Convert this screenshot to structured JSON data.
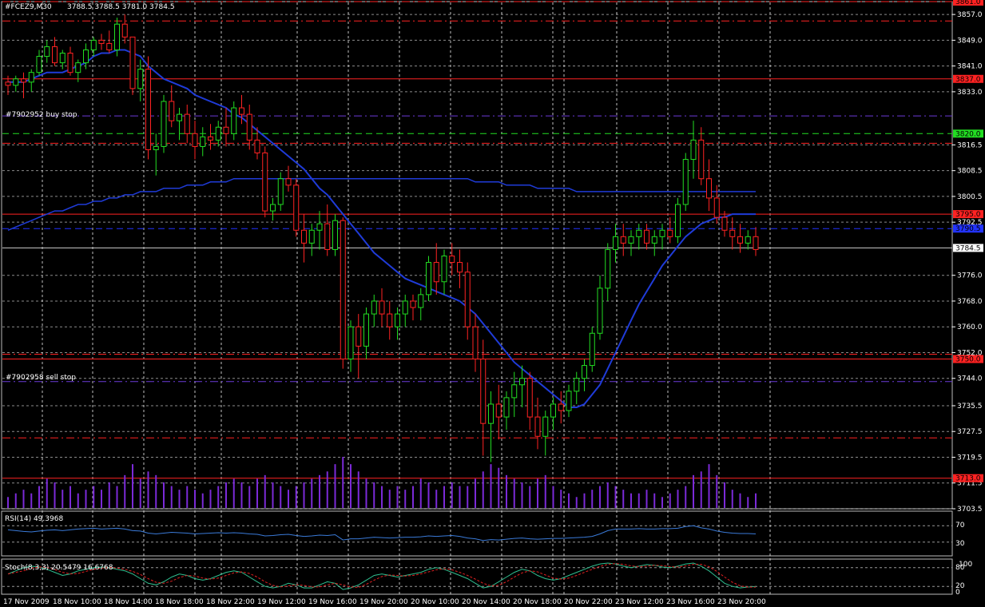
{
  "header": {
    "symbol_tf": "#FCEZ9,M30",
    "ohlc": "3788.5 3788.5 3781.0 3784.5"
  },
  "annotations": {
    "buy_stop": "#7902952 buy stop",
    "sell_stop": "#7902958 sell stop"
  },
  "indicators": {
    "rsi_label": "RSI(14) 49.3968",
    "rsi_levels": [
      "70",
      "30"
    ],
    "stoch_label": "Stoch(8,3,3) 20.5479 16.6768",
    "stoch_levels": [
      "80",
      "20"
    ],
    "stoch_top": "100",
    "stoch_bottom": "0"
  },
  "colors": {
    "background": "#000000",
    "bull_candle": "#22dd22",
    "bear_candle": "#ff2222",
    "moving_average": "#1f3bd8",
    "volume": "#7b2ad8",
    "grid": "#ffffff",
    "indicator_line": "#3a7ad8",
    "signal_line": "#e02020"
  },
  "chart_data": {
    "type": "candlestick",
    "symbol": "#FCEZ9",
    "timeframe": "M30",
    "y_ticks": [
      "3857.0",
      "3849.0",
      "3841.0",
      "3833.0",
      "3816.5",
      "3808.5",
      "3800.5",
      "3792.5",
      "3776.0",
      "3768.0",
      "3760.0",
      "3752.0",
      "3744.0",
      "3735.5",
      "3727.5",
      "3719.5",
      "3711.5",
      "3703.5"
    ],
    "ylim": [
      3703.5,
      3861.0
    ],
    "x_labels": [
      "17 Nov 2009",
      "18 Nov 10:00",
      "18 Nov 14:00",
      "18 Nov 18:00",
      "18 Nov 22:00",
      "19 Nov 12:00",
      "19 Nov 16:00",
      "19 Nov 20:00",
      "20 Nov 10:00",
      "20 Nov 14:00",
      "20 Nov 18:00",
      "20 Nov 22:00",
      "23 Nov 12:00",
      "23 Nov 16:00",
      "23 Nov 20:00"
    ],
    "current_price": "3784.5",
    "price_levels": [
      {
        "value": 3861.0,
        "label": "3861.0",
        "style": "dashdot",
        "color": "#ff2222"
      },
      {
        "value": 3837.0,
        "label": "3837.0",
        "style": "solid",
        "color": "#ff2222"
      },
      {
        "value": 3820.0,
        "label": "3820.0",
        "style": "dashed",
        "color": "#22dd22"
      },
      {
        "value": 3795.0,
        "label": "3795.0",
        "style": "solid",
        "color": "#ff2222"
      },
      {
        "value": 3790.5,
        "label": "3790.5",
        "style": "dashed",
        "color": "#2233ff"
      },
      {
        "value": 3750.0,
        "label": "3750.0",
        "style": "solid",
        "color": "#ff2222"
      },
      {
        "value": 3713.0,
        "label": "3713.0",
        "style": "solid",
        "color": "#ff2222"
      }
    ],
    "other_levels": [
      3855.0,
      3825.5,
      3817.0,
      3751.5,
      3743.0,
      3725.5
    ],
    "candles": [
      [
        3836,
        3838,
        3832,
        3835
      ],
      [
        3835,
        3838,
        3833,
        3837
      ],
      [
        3837,
        3839,
        3831,
        3836
      ],
      [
        3836,
        3840,
        3833,
        3839
      ],
      [
        3839,
        3846,
        3838,
        3844
      ],
      [
        3844,
        3849,
        3842,
        3847
      ],
      [
        3847,
        3850,
        3841,
        3842
      ],
      [
        3842,
        3846,
        3840,
        3845
      ],
      [
        3845,
        3847,
        3838,
        3839
      ],
      [
        3839,
        3843,
        3836,
        3842
      ],
      [
        3842,
        3848,
        3840,
        3846
      ],
      [
        3846,
        3850,
        3844,
        3849
      ],
      [
        3849,
        3851,
        3846,
        3848
      ],
      [
        3848,
        3852,
        3845,
        3846
      ],
      [
        3846,
        3856,
        3844,
        3854
      ],
      [
        3854,
        3857,
        3848,
        3850
      ],
      [
        3850,
        3846,
        3832,
        3834
      ],
      [
        3834,
        3843,
        3830,
        3840
      ],
      [
        3840,
        3844,
        3812,
        3815
      ],
      [
        3815,
        3820,
        3807,
        3816
      ],
      [
        3816,
        3832,
        3814,
        3830
      ],
      [
        3830,
        3835,
        3822,
        3824
      ],
      [
        3824,
        3828,
        3818,
        3826
      ],
      [
        3826,
        3829,
        3817,
        3820
      ],
      [
        3820,
        3824,
        3812,
        3816
      ],
      [
        3816,
        3822,
        3813,
        3819
      ],
      [
        3819,
        3823,
        3815,
        3818
      ],
      [
        3818,
        3824,
        3816,
        3822
      ],
      [
        3822,
        3828,
        3816,
        3820
      ],
      [
        3820,
        3830,
        3818,
        3828
      ],
      [
        3828,
        3832,
        3823,
        3826
      ],
      [
        3826,
        3829,
        3815,
        3818
      ],
      [
        3818,
        3822,
        3812,
        3814
      ],
      [
        3814,
        3816,
        3794,
        3796
      ],
      [
        3796,
        3800,
        3793,
        3798
      ],
      [
        3798,
        3808,
        3796,
        3806
      ],
      [
        3806,
        3810,
        3802,
        3804
      ],
      [
        3804,
        3806,
        3788,
        3790
      ],
      [
        3790,
        3795,
        3780,
        3786
      ],
      [
        3786,
        3792,
        3782,
        3790
      ],
      [
        3790,
        3796,
        3784,
        3792
      ],
      [
        3792,
        3798,
        3782,
        3784
      ],
      [
        3784,
        3795,
        3782,
        3793
      ],
      [
        3793,
        3794,
        3747,
        3750
      ],
      [
        3750,
        3762,
        3746,
        3760
      ],
      [
        3760,
        3764,
        3744,
        3754
      ],
      [
        3754,
        3766,
        3750,
        3764
      ],
      [
        3764,
        3770,
        3760,
        3768
      ],
      [
        3768,
        3772,
        3760,
        3764
      ],
      [
        3764,
        3768,
        3756,
        3760
      ],
      [
        3760,
        3766,
        3756,
        3764
      ],
      [
        3764,
        3770,
        3760,
        3768
      ],
      [
        3768,
        3770,
        3762,
        3766
      ],
      [
        3766,
        3772,
        3762,
        3770
      ],
      [
        3770,
        3782,
        3768,
        3780
      ],
      [
        3780,
        3786,
        3770,
        3774
      ],
      [
        3774,
        3784,
        3770,
        3782
      ],
      [
        3782,
        3786,
        3776,
        3780
      ],
      [
        3780,
        3784,
        3772,
        3777
      ],
      [
        3777,
        3780,
        3756,
        3760
      ],
      [
        3760,
        3764,
        3746,
        3750
      ],
      [
        3750,
        3756,
        3720,
        3730
      ],
      [
        3730,
        3740,
        3718,
        3736
      ],
      [
        3736,
        3742,
        3725,
        3732
      ],
      [
        3732,
        3740,
        3728,
        3738
      ],
      [
        3738,
        3746,
        3732,
        3742
      ],
      [
        3742,
        3748,
        3735,
        3744
      ],
      [
        3744,
        3746,
        3728,
        3732
      ],
      [
        3732,
        3738,
        3722,
        3726
      ],
      [
        3726,
        3734,
        3720,
        3732
      ],
      [
        3732,
        3738,
        3728,
        3736
      ],
      [
        3736,
        3740,
        3730,
        3734
      ],
      [
        3734,
        3742,
        3732,
        3740
      ],
      [
        3740,
        3746,
        3736,
        3744
      ],
      [
        3744,
        3750,
        3740,
        3748
      ],
      [
        3748,
        3760,
        3746,
        3758
      ],
      [
        3758,
        3776,
        3756,
        3772
      ],
      [
        3772,
        3786,
        3768,
        3784
      ],
      [
        3784,
        3792,
        3780,
        3788
      ],
      [
        3788,
        3792,
        3782,
        3786
      ],
      [
        3786,
        3790,
        3782,
        3788
      ],
      [
        3788,
        3792,
        3784,
        3790
      ],
      [
        3790,
        3792,
        3784,
        3786
      ],
      [
        3786,
        3790,
        3782,
        3788
      ],
      [
        3788,
        3792,
        3784,
        3790
      ],
      [
        3790,
        3794,
        3786,
        3788
      ],
      [
        3788,
        3800,
        3786,
        3798
      ],
      [
        3798,
        3814,
        3796,
        3812
      ],
      [
        3812,
        3824,
        3806,
        3818
      ],
      [
        3818,
        3822,
        3804,
        3806
      ],
      [
        3806,
        3812,
        3796,
        3800
      ],
      [
        3800,
        3804,
        3792,
        3794
      ],
      [
        3794,
        3796,
        3788,
        3790
      ],
      [
        3790,
        3794,
        3784,
        3788
      ],
      [
        3788,
        3792,
        3783,
        3786
      ],
      [
        3786,
        3790,
        3784,
        3788
      ],
      [
        3788,
        3791,
        3782,
        3784
      ]
    ],
    "ma_fast": [
      3836,
      3836,
      3836,
      3837,
      3838,
      3839,
      3839,
      3839,
      3840,
      3841,
      3842,
      3844,
      3845,
      3845,
      3846,
      3846,
      3845,
      3844,
      3841,
      3839,
      3837,
      3836,
      3835,
      3834,
      3832,
      3831,
      3830,
      3829,
      3828,
      3826,
      3825,
      3823,
      3821,
      3819,
      3817,
      3815,
      3813,
      3811,
      3809,
      3806,
      3803,
      3801,
      3798,
      3795,
      3792,
      3789,
      3786,
      3783,
      3781,
      3779,
      3777,
      3775,
      3774,
      3773,
      3772,
      3771,
      3770,
      3769,
      3768,
      3766,
      3764,
      3761,
      3758,
      3755,
      3752,
      3749,
      3747,
      3745,
      3743,
      3741,
      3739,
      3737,
      3735,
      3735,
      3736,
      3739,
      3742,
      3747,
      3752,
      3757,
      3762,
      3767,
      3771,
      3775,
      3779,
      3782,
      3785,
      3788,
      3790,
      3792,
      3793,
      3794,
      3794,
      3795,
      3795,
      3795,
      3795
    ],
    "ma_slow": [
      3790,
      3791,
      3792,
      3793,
      3794,
      3795,
      3796,
      3796,
      3797,
      3798,
      3798,
      3799,
      3799,
      3800,
      3800,
      3801,
      3801,
      3802,
      3802,
      3802,
      3803,
      3803,
      3803,
      3804,
      3804,
      3804,
      3805,
      3805,
      3805,
      3806,
      3806,
      3806,
      3806,
      3806,
      3806,
      3806,
      3806,
      3806,
      3806,
      3806,
      3806,
      3806,
      3806,
      3806,
      3806,
      3806,
      3806,
      3806,
      3806,
      3806,
      3806,
      3806,
      3806,
      3806,
      3806,
      3806,
      3806,
      3806,
      3806,
      3806,
      3805,
      3805,
      3805,
      3805,
      3804,
      3804,
      3804,
      3804,
      3803,
      3803,
      3803,
      3803,
      3803,
      3802,
      3802,
      3802,
      3802,
      3802,
      3802,
      3802,
      3802,
      3802,
      3802,
      3802,
      3802,
      3802,
      3802,
      3802,
      3802,
      3802,
      3802,
      3802,
      3802,
      3802,
      3802,
      3802,
      3802
    ],
    "volume": [
      3,
      4,
      5,
      4,
      6,
      8,
      7,
      5,
      6,
      4,
      5,
      6,
      5,
      7,
      6,
      9,
      12,
      8,
      10,
      9,
      7,
      6,
      5,
      6,
      5,
      4,
      5,
      6,
      7,
      8,
      7,
      6,
      8,
      9,
      7,
      6,
      5,
      6,
      7,
      8,
      9,
      10,
      12,
      14,
      12,
      10,
      8,
      7,
      6,
      5,
      6,
      5,
      6,
      8,
      7,
      5,
      6,
      7,
      6,
      6,
      8,
      10,
      12,
      11,
      9,
      8,
      7,
      6,
      8,
      9,
      6,
      5,
      4,
      3,
      4,
      5,
      6,
      7,
      6,
      5,
      4,
      4,
      5,
      4,
      3,
      4,
      5,
      6,
      9,
      10,
      12,
      9,
      7,
      5,
      4,
      3,
      4
    ],
    "rsi": [
      60,
      58,
      56,
      55,
      57,
      59,
      60,
      58,
      60,
      62,
      63,
      64,
      62,
      63,
      64,
      62,
      58,
      57,
      52,
      50,
      52,
      54,
      53,
      52,
      50,
      51,
      52,
      53,
      52,
      53,
      52,
      50,
      49,
      45,
      46,
      48,
      49,
      46,
      44,
      45,
      47,
      46,
      48,
      35,
      38,
      38,
      40,
      42,
      41,
      40,
      41,
      42,
      42,
      43,
      45,
      44,
      45,
      46,
      44,
      40,
      38,
      34,
      36,
      35,
      37,
      39,
      40,
      38,
      37,
      38,
      39,
      39,
      40,
      41,
      42,
      44,
      50,
      58,
      62,
      62,
      62,
      63,
      62,
      62,
      63,
      63,
      64,
      68,
      70,
      65,
      62,
      57,
      54,
      52,
      51,
      51,
      50
    ],
    "stoch": [
      60,
      70,
      80,
      85,
      82,
      75,
      65,
      55,
      60,
      70,
      75,
      80,
      82,
      80,
      75,
      70,
      60,
      45,
      30,
      25,
      35,
      50,
      60,
      55,
      45,
      40,
      45,
      55,
      65,
      70,
      65,
      50,
      35,
      20,
      15,
      20,
      30,
      25,
      15,
      15,
      25,
      35,
      30,
      10,
      15,
      25,
      40,
      55,
      60,
      55,
      50,
      55,
      60,
      65,
      75,
      80,
      75,
      65,
      55,
      45,
      30,
      15,
      20,
      35,
      50,
      65,
      75,
      70,
      55,
      45,
      40,
      45,
      55,
      65,
      75,
      85,
      92,
      95,
      92,
      85,
      80,
      85,
      90,
      88,
      82,
      80,
      85,
      92,
      95,
      85,
      70,
      50,
      30,
      20,
      15,
      18,
      20
    ]
  }
}
